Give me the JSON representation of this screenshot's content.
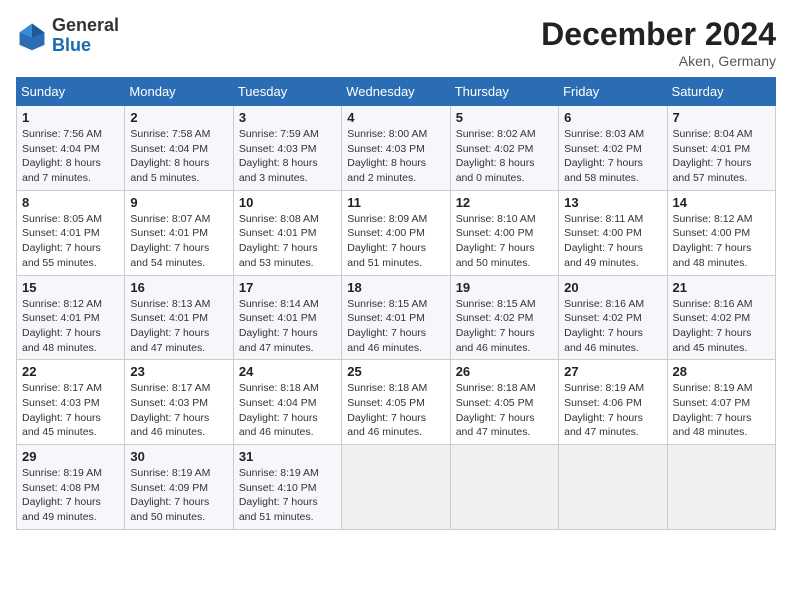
{
  "header": {
    "logo_general": "General",
    "logo_blue": "Blue",
    "month": "December 2024",
    "location": "Aken, Germany"
  },
  "weekdays": [
    "Sunday",
    "Monday",
    "Tuesday",
    "Wednesday",
    "Thursday",
    "Friday",
    "Saturday"
  ],
  "weeks": [
    [
      {
        "day": "1",
        "sunrise": "Sunrise: 7:56 AM",
        "sunset": "Sunset: 4:04 PM",
        "daylight": "Daylight: 8 hours and 7 minutes."
      },
      {
        "day": "2",
        "sunrise": "Sunrise: 7:58 AM",
        "sunset": "Sunset: 4:04 PM",
        "daylight": "Daylight: 8 hours and 5 minutes."
      },
      {
        "day": "3",
        "sunrise": "Sunrise: 7:59 AM",
        "sunset": "Sunset: 4:03 PM",
        "daylight": "Daylight: 8 hours and 3 minutes."
      },
      {
        "day": "4",
        "sunrise": "Sunrise: 8:00 AM",
        "sunset": "Sunset: 4:03 PM",
        "daylight": "Daylight: 8 hours and 2 minutes."
      },
      {
        "day": "5",
        "sunrise": "Sunrise: 8:02 AM",
        "sunset": "Sunset: 4:02 PM",
        "daylight": "Daylight: 8 hours and 0 minutes."
      },
      {
        "day": "6",
        "sunrise": "Sunrise: 8:03 AM",
        "sunset": "Sunset: 4:02 PM",
        "daylight": "Daylight: 7 hours and 58 minutes."
      },
      {
        "day": "7",
        "sunrise": "Sunrise: 8:04 AM",
        "sunset": "Sunset: 4:01 PM",
        "daylight": "Daylight: 7 hours and 57 minutes."
      }
    ],
    [
      {
        "day": "8",
        "sunrise": "Sunrise: 8:05 AM",
        "sunset": "Sunset: 4:01 PM",
        "daylight": "Daylight: 7 hours and 55 minutes."
      },
      {
        "day": "9",
        "sunrise": "Sunrise: 8:07 AM",
        "sunset": "Sunset: 4:01 PM",
        "daylight": "Daylight: 7 hours and 54 minutes."
      },
      {
        "day": "10",
        "sunrise": "Sunrise: 8:08 AM",
        "sunset": "Sunset: 4:01 PM",
        "daylight": "Daylight: 7 hours and 53 minutes."
      },
      {
        "day": "11",
        "sunrise": "Sunrise: 8:09 AM",
        "sunset": "Sunset: 4:00 PM",
        "daylight": "Daylight: 7 hours and 51 minutes."
      },
      {
        "day": "12",
        "sunrise": "Sunrise: 8:10 AM",
        "sunset": "Sunset: 4:00 PM",
        "daylight": "Daylight: 7 hours and 50 minutes."
      },
      {
        "day": "13",
        "sunrise": "Sunrise: 8:11 AM",
        "sunset": "Sunset: 4:00 PM",
        "daylight": "Daylight: 7 hours and 49 minutes."
      },
      {
        "day": "14",
        "sunrise": "Sunrise: 8:12 AM",
        "sunset": "Sunset: 4:00 PM",
        "daylight": "Daylight: 7 hours and 48 minutes."
      }
    ],
    [
      {
        "day": "15",
        "sunrise": "Sunrise: 8:12 AM",
        "sunset": "Sunset: 4:01 PM",
        "daylight": "Daylight: 7 hours and 48 minutes."
      },
      {
        "day": "16",
        "sunrise": "Sunrise: 8:13 AM",
        "sunset": "Sunset: 4:01 PM",
        "daylight": "Daylight: 7 hours and 47 minutes."
      },
      {
        "day": "17",
        "sunrise": "Sunrise: 8:14 AM",
        "sunset": "Sunset: 4:01 PM",
        "daylight": "Daylight: 7 hours and 47 minutes."
      },
      {
        "day": "18",
        "sunrise": "Sunrise: 8:15 AM",
        "sunset": "Sunset: 4:01 PM",
        "daylight": "Daylight: 7 hours and 46 minutes."
      },
      {
        "day": "19",
        "sunrise": "Sunrise: 8:15 AM",
        "sunset": "Sunset: 4:02 PM",
        "daylight": "Daylight: 7 hours and 46 minutes."
      },
      {
        "day": "20",
        "sunrise": "Sunrise: 8:16 AM",
        "sunset": "Sunset: 4:02 PM",
        "daylight": "Daylight: 7 hours and 46 minutes."
      },
      {
        "day": "21",
        "sunrise": "Sunrise: 8:16 AM",
        "sunset": "Sunset: 4:02 PM",
        "daylight": "Daylight: 7 hours and 45 minutes."
      }
    ],
    [
      {
        "day": "22",
        "sunrise": "Sunrise: 8:17 AM",
        "sunset": "Sunset: 4:03 PM",
        "daylight": "Daylight: 7 hours and 45 minutes."
      },
      {
        "day": "23",
        "sunrise": "Sunrise: 8:17 AM",
        "sunset": "Sunset: 4:03 PM",
        "daylight": "Daylight: 7 hours and 46 minutes."
      },
      {
        "day": "24",
        "sunrise": "Sunrise: 8:18 AM",
        "sunset": "Sunset: 4:04 PM",
        "daylight": "Daylight: 7 hours and 46 minutes."
      },
      {
        "day": "25",
        "sunrise": "Sunrise: 8:18 AM",
        "sunset": "Sunset: 4:05 PM",
        "daylight": "Daylight: 7 hours and 46 minutes."
      },
      {
        "day": "26",
        "sunrise": "Sunrise: 8:18 AM",
        "sunset": "Sunset: 4:05 PM",
        "daylight": "Daylight: 7 hours and 47 minutes."
      },
      {
        "day": "27",
        "sunrise": "Sunrise: 8:19 AM",
        "sunset": "Sunset: 4:06 PM",
        "daylight": "Daylight: 7 hours and 47 minutes."
      },
      {
        "day": "28",
        "sunrise": "Sunrise: 8:19 AM",
        "sunset": "Sunset: 4:07 PM",
        "daylight": "Daylight: 7 hours and 48 minutes."
      }
    ],
    [
      {
        "day": "29",
        "sunrise": "Sunrise: 8:19 AM",
        "sunset": "Sunset: 4:08 PM",
        "daylight": "Daylight: 7 hours and 49 minutes."
      },
      {
        "day": "30",
        "sunrise": "Sunrise: 8:19 AM",
        "sunset": "Sunset: 4:09 PM",
        "daylight": "Daylight: 7 hours and 50 minutes."
      },
      {
        "day": "31",
        "sunrise": "Sunrise: 8:19 AM",
        "sunset": "Sunset: 4:10 PM",
        "daylight": "Daylight: 7 hours and 51 minutes."
      },
      null,
      null,
      null,
      null
    ]
  ]
}
